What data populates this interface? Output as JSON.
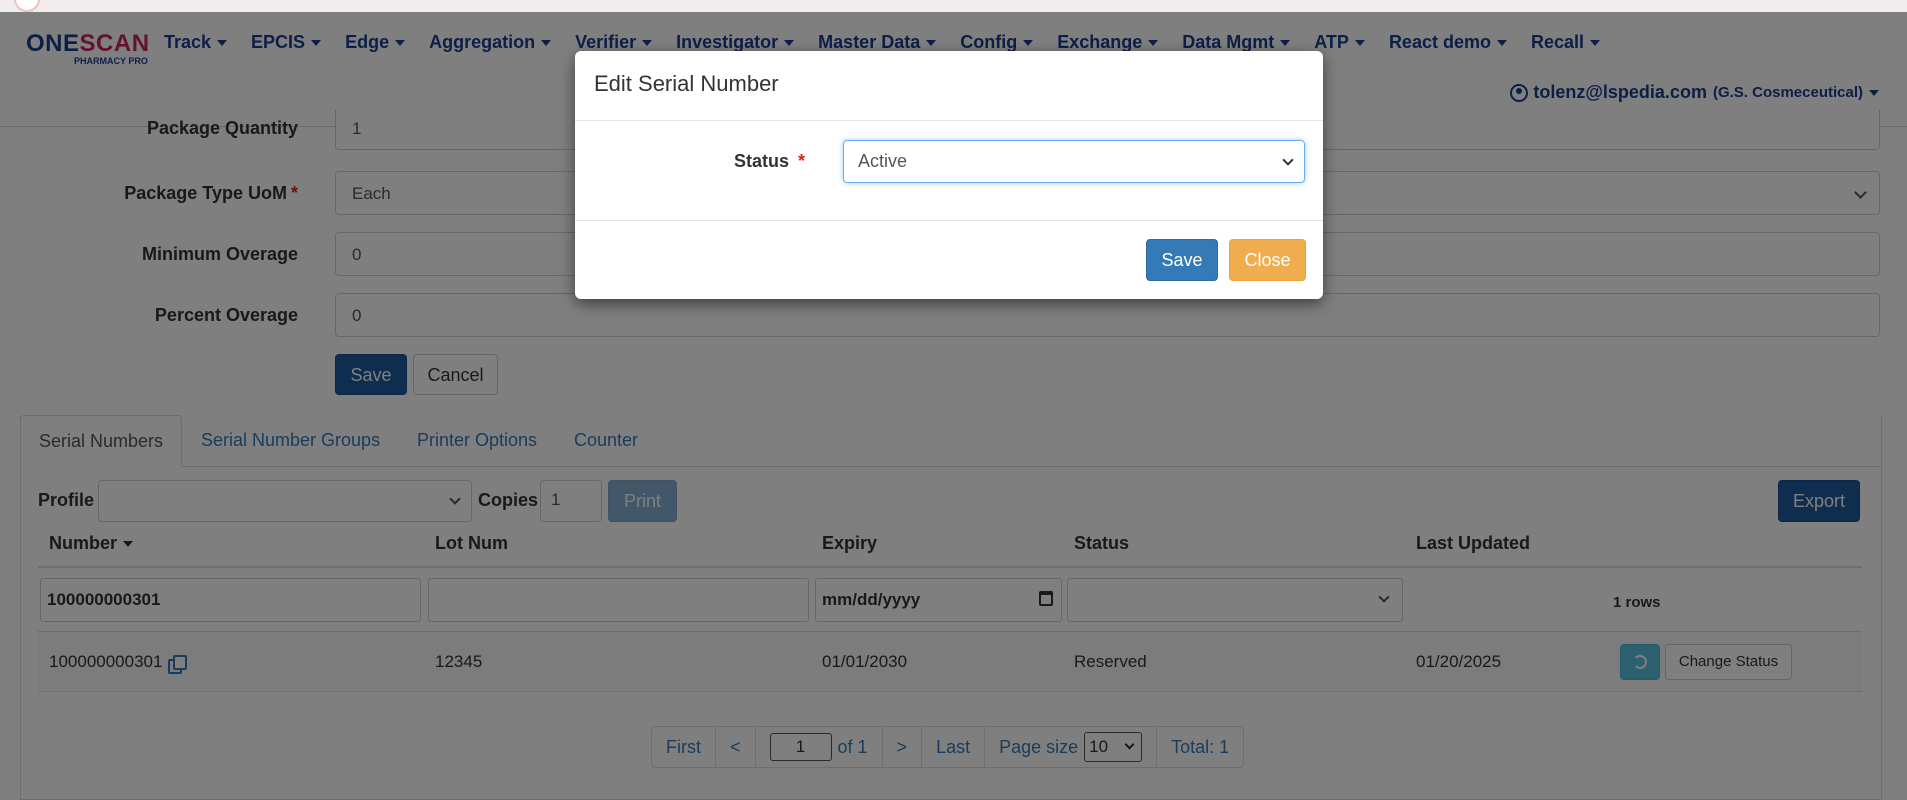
{
  "nav": {
    "logo": {
      "word_a": "ONE",
      "word_b": "SCAN",
      "sub": "PHARMACY PRO"
    },
    "menu": [
      "Track",
      "EPCIS",
      "Edge",
      "Aggregation",
      "Verifier",
      "Investigator",
      "Master Data",
      "Config",
      "Exchange",
      "Data Mgmt",
      "ATP",
      "React demo",
      "Recall"
    ],
    "user": {
      "email": "tolenz@lspedia.com",
      "company": "(G.S. Cosmeceutical)",
      "icon": "user-circle-icon"
    }
  },
  "form": {
    "fields": [
      {
        "label": "Package Quantity",
        "value": "1",
        "required": false
      },
      {
        "label": "Package Type UoM",
        "value": "Each",
        "required": true,
        "type": "select"
      },
      {
        "label": "Minimum Overage",
        "value": "0",
        "required": false
      },
      {
        "label": "Percent Overage",
        "value": "0",
        "required": false
      }
    ],
    "required_mark": "*",
    "save_label": "Save",
    "cancel_label": "Cancel"
  },
  "tabs": [
    "Serial Numbers",
    "Serial Number Groups",
    "Printer Options",
    "Counter"
  ],
  "toolbar": {
    "profile_label": "Profile",
    "profile_value": "",
    "copies_label": "Copies",
    "copies_value": "1",
    "print_label": "Print",
    "export_label": "Export"
  },
  "table": {
    "columns": [
      "Number",
      "Lot Num",
      "Expiry",
      "Status",
      "Last Updated"
    ],
    "filters": {
      "number": "100000000301",
      "lot": "",
      "expiry_placeholder": "mm/dd/yyyy",
      "status": "",
      "rows_count": "1 rows"
    },
    "rows": [
      {
        "number": "100000000301",
        "lot": "12345",
        "expiry": "01/01/2030",
        "status": "Reserved",
        "last_updated": "01/20/2025",
        "action_label": "Change Status"
      }
    ]
  },
  "pager": {
    "first": "First",
    "prev": "<",
    "page": "1",
    "of": "of 1",
    "next": ">",
    "last": "Last",
    "page_size_label": "Page size",
    "page_size": "10",
    "total": "Total: 1"
  },
  "modal": {
    "title": "Edit Serial Number",
    "status_label": "Status",
    "required_mark": "*",
    "status_value": "Active",
    "save_label": "Save",
    "close_label": "Close"
  },
  "colors": {
    "brand": "#1b3f8f",
    "accent": "#c8245c",
    "primary": "#337ab7",
    "warning": "#f0ad4e"
  }
}
